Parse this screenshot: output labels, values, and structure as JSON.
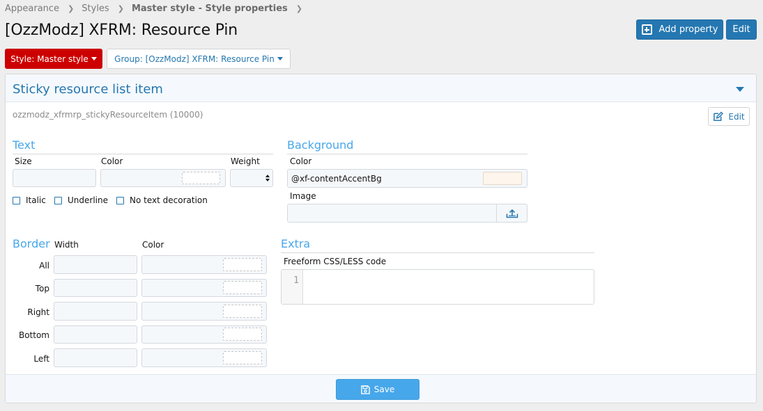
{
  "breadcrumb": [
    "Appearance",
    "Styles",
    "Master style - Style properties"
  ],
  "page_title": "[OzzModz] XFRM: Resource Pin",
  "header_buttons": {
    "add_property": "Add property",
    "edit": "Edit"
  },
  "filters": {
    "style": "Style: Master style",
    "group": "Group: [OzzModz] XFRM: Resource Pin"
  },
  "panel": {
    "title": "Sticky resource list item",
    "property_id": "ozzmodz_xfrmrp_stickyResourceItem (10000)",
    "edit_label": "Edit"
  },
  "text_section": {
    "title": "Text",
    "size_label": "Size",
    "color_label": "Color",
    "weight_label": "Weight",
    "size_value": "",
    "color_value": "",
    "weight_value": "",
    "italic_label": "Italic",
    "underline_label": "Underline",
    "no_decoration_label": "No text decoration"
  },
  "background_section": {
    "title": "Background",
    "color_label": "Color",
    "color_value": "@xf-contentAccentBg",
    "swatch_color": "#fef5ec",
    "image_label": "Image",
    "image_value": ""
  },
  "border_section": {
    "title": "Border",
    "width_label": "Width",
    "color_label": "Color",
    "rows": [
      "All",
      "Top",
      "Right",
      "Bottom",
      "Left"
    ]
  },
  "extra_section": {
    "title": "Extra",
    "code_label": "Freeform CSS/LESS code",
    "line_number": "1"
  },
  "footer": {
    "save_label": "Save"
  },
  "colors": {
    "accent": "#2577b1",
    "light_accent": "#47a7eb",
    "style_button": "#cc0000"
  }
}
